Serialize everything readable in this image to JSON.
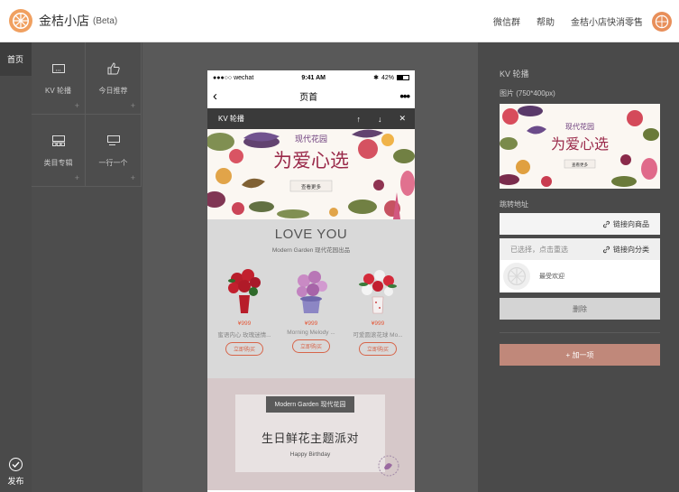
{
  "app": {
    "name": "金桔小店",
    "badge": "(Beta)",
    "nav_links": [
      "微信群",
      "帮助",
      "金桔小店快消零售"
    ],
    "brand_color": "#f0a060"
  },
  "left_nav": {
    "home_label": "首页",
    "publish_label": "发布"
  },
  "components": [
    {
      "label": "KV 轮播",
      "icon": "carousel-icon"
    },
    {
      "label": "今日推荐",
      "icon": "thumbs-up-icon"
    },
    {
      "label": "类目专辑",
      "icon": "category-icon"
    },
    {
      "label": "一行一个",
      "icon": "single-row-icon"
    }
  ],
  "phone": {
    "carrier": "●●●○○ wechat",
    "time": "9:41 AM",
    "battery": "42%",
    "page_title": "页首",
    "kv_toolbar": {
      "label": "KV 轮播",
      "up": "↑",
      "down": "↓",
      "close": "✕"
    },
    "banner": {
      "title": "现代花园",
      "headline": "为爱心选",
      "button": "查看更多"
    },
    "love_section": {
      "heading": "LOVE YOU",
      "subheading": "Modern Garden 现代花园出品",
      "products": [
        {
          "price": "¥999",
          "name": "蜜语内心 玫瑰迷情...",
          "button": "立即购买"
        },
        {
          "price": "¥999",
          "name": "Morning Melody ...",
          "button": "立即购买"
        },
        {
          "price": "¥999",
          "name": "可爱圆滚花球 Mo...",
          "button": "立即购买"
        }
      ]
    },
    "party_section": {
      "tag": "Modern Garden 现代花园",
      "title": "生日鲜花主题派对",
      "subtitle": "Happy Birthday"
    }
  },
  "settings": {
    "title": "KV 轮播",
    "image_label": "图片 (750*400px)",
    "link_label": "跳转地址",
    "link_product_button": "链接向商品",
    "selected_placeholder": "已选择，点击重选",
    "link_category_button": "链接向分类",
    "selected_item": "最受欢迎",
    "delete_button": "删除",
    "add_button": "+ 加一项",
    "add_button_color": "#c0887a"
  }
}
